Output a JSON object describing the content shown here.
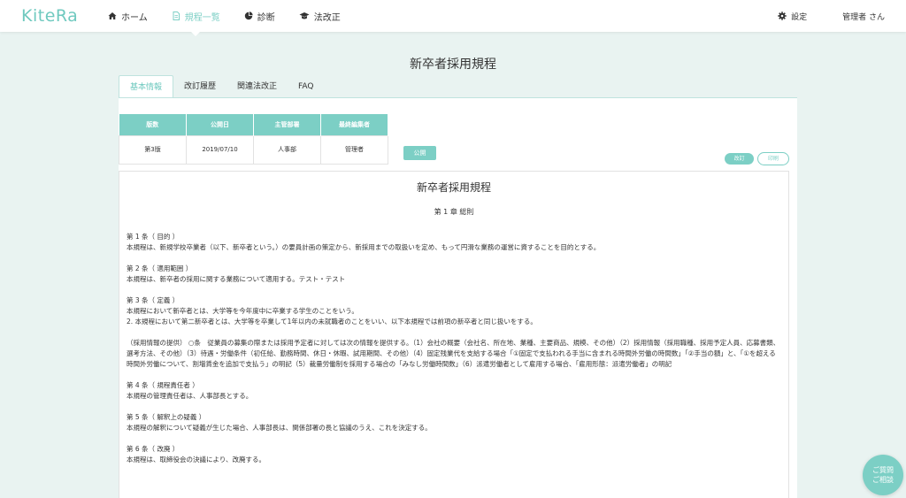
{
  "app": {
    "logo": "KiteRa"
  },
  "nav": {
    "items": [
      {
        "label": "ホーム",
        "icon": "home-icon"
      },
      {
        "label": "規程一覧",
        "icon": "document-icon"
      },
      {
        "label": "診断",
        "icon": "pie-chart-icon"
      },
      {
        "label": "法改正",
        "icon": "graduation-cap-icon"
      }
    ],
    "settings": "設定",
    "user": "管理者 さん"
  },
  "page": {
    "title": "新卒者採用規程"
  },
  "tabs": [
    "基本情報",
    "改訂履歴",
    "関連法改正",
    "FAQ"
  ],
  "info_table": {
    "headers": [
      "版数",
      "公開日",
      "主管部署",
      "最終編集者"
    ],
    "row": [
      "第3版",
      "2019/07/10",
      "人事部",
      "管理者"
    ]
  },
  "status_badge": "公開",
  "actions": {
    "revise": "改訂",
    "print": "印刷"
  },
  "document": {
    "title": "新卒者採用規程",
    "chapter": "第 1 章 総則",
    "articles": [
      [
        "第 1 条（ 目的 ）",
        "本規程は、新規学校卒業者（以下、新卒者という。）の要員計画の策定から、新採用までの取扱いを定め、もって円滑な業務の運営に資することを目的とする。"
      ],
      [
        "第 2 条（ 適用範囲 ）",
        "本規程は、新卒者の採用に関する業務について適用する。テスト・テスト"
      ],
      [
        "第 3 条（ 定義 ）",
        "本規程において新卒者とは、大学等を今年度中に卒業する学生のことをいう。",
        "2. 本規程において第二新卒者とは、大学等を卒業して1年以内の未就職者のことをいい、以下本規程では前項の新卒者と同じ扱いをする。"
      ],
      [
        "（採用情報の提供） ○条　従業員の募集の際または採用予定者に対しては次の情報を提供する。（1）会社の概要（会社名、所在地、業種、主要商品、規模、その他）（2）採用情報（採用職種、採用予定人員、応募書類、選考方法、その他）（3）待遇・労働条件（初任給、勤務時間、休日・休暇、試用期間、その他）（4）固定残業代を支給する場合「①固定で支払われる手当に含まれる時間外労働の時間数」「②手当の額」と、「①を超える時間外労働について、割増賃金を追加で支払う」の明記（5）裁量労働制を採用する場合の「みなし労働時間数」（6）派遣労働者として雇用する場合、「雇用形態：派遣労働者」の明記"
      ],
      [
        "第 4 条（ 規程責任者 ）",
        "本規程の管理責任者は、人事部長とする。"
      ],
      [
        "第 5 条（ 解釈上の疑義 ）",
        "本規程の解釈について疑義が生じた場合、人事部長は、関係部署の長と協議のうえ、これを決定する。"
      ],
      [
        "第 6 条（ 改廃 ）",
        "本規程は、取締役会の決議により、改廃する。"
      ]
    ]
  },
  "chat": {
    "line1": "ご質問",
    "line2": "ご相談"
  },
  "colors": {
    "accent": "#7ccfc5",
    "background": "#e9f3f1"
  }
}
